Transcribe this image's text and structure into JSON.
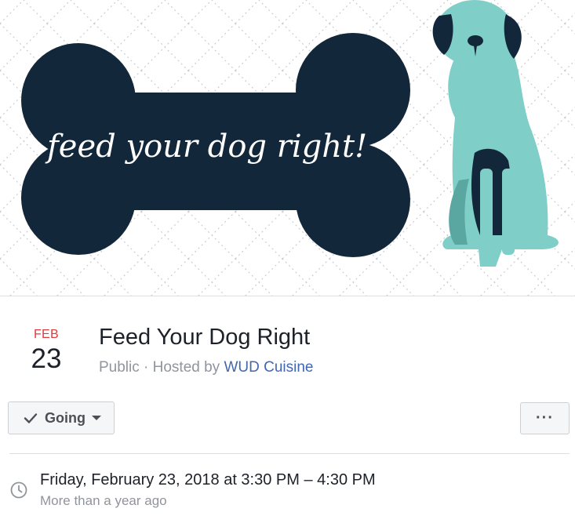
{
  "cover": {
    "text": "feed your dog right!",
    "colors": {
      "bone": "#13273a",
      "dog": "#7fcec7",
      "dog_shadow": "#5aa6a0",
      "pattern": "#c9cdd1"
    }
  },
  "event": {
    "month": "FEB",
    "day": "23",
    "title": "Feed Your Dog Right",
    "privacy": "Public",
    "separator": " · ",
    "hosted_by_prefix": "Hosted by ",
    "host": "WUD Cuisine"
  },
  "actions": {
    "going_label": "Going",
    "more_label": "···"
  },
  "datetime": {
    "main": "Friday, February 23, 2018 at 3:30 PM – 4:30 PM",
    "relative": "More than a year ago"
  },
  "icons": [
    "check-icon",
    "caret-down-icon",
    "clock-icon"
  ]
}
